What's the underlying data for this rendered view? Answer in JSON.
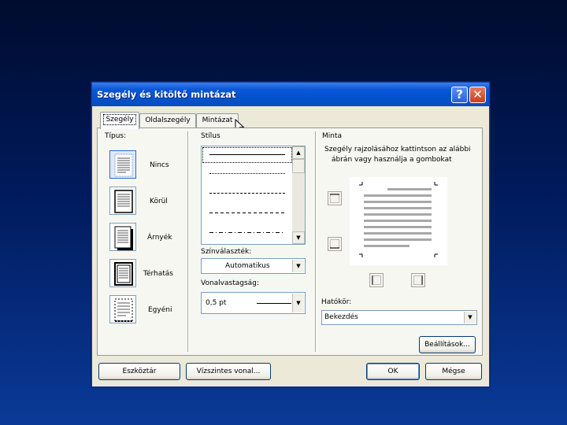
{
  "dialog": {
    "title": "Szegély és kitöltő mintázat",
    "help_symbol": "?",
    "close_symbol": "✕"
  },
  "tabs": [
    {
      "label": "Szegély",
      "active": true
    },
    {
      "label": "Oldalszegély",
      "active": false
    },
    {
      "label": "Mintázat",
      "active": false
    }
  ],
  "type_section": {
    "label": "Típus:",
    "options": [
      {
        "label": "Nincs",
        "icon": "border-none-icon",
        "selected": true
      },
      {
        "label": "Körül",
        "icon": "border-box-icon",
        "selected": false
      },
      {
        "label": "Árnyék",
        "icon": "border-shadow-icon",
        "selected": false
      },
      {
        "label": "Térhatás",
        "icon": "border-3d-icon",
        "selected": false
      },
      {
        "label": "Egyéni",
        "icon": "border-custom-icon",
        "selected": false
      }
    ]
  },
  "style_section": {
    "label": "Stílus",
    "styles": [
      "solid",
      "dotted",
      "dashed-fine",
      "dashed",
      "dash-dot"
    ],
    "color_label": "Színválaszték:",
    "color_value": "Automatikus",
    "width_label": "Vonalvastagság:",
    "width_value": "0,5 pt"
  },
  "preview_section": {
    "label": "Minta",
    "hint_line1": "Szegély rajzolásához kattintson az alábbi",
    "hint_line2": "ábrán vagy használja a gombokat",
    "apply_label": "Hatókör:",
    "apply_value": "Bekezdés",
    "options_button": "Beállítások..."
  },
  "footer": {
    "toolbar_button": "Eszköztár",
    "horizontal_line_button": "Vízszintes vonal...",
    "ok_button": "OK",
    "cancel_button": "Mégse"
  },
  "colors": {
    "titlebar": "#0052cc",
    "dialog_bg": "#ece9d8",
    "desktop_bg": "#001a5c"
  }
}
